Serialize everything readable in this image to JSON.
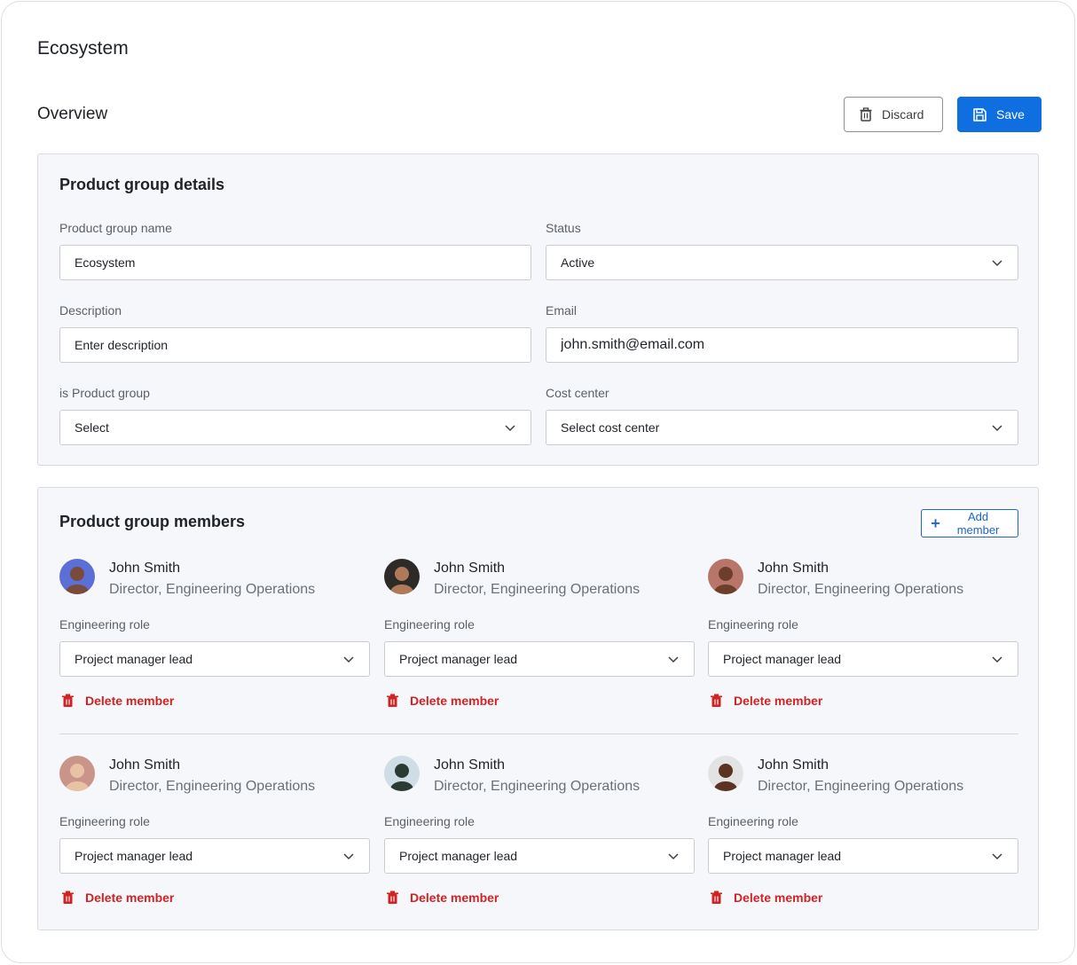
{
  "app": {
    "title": "Ecosystem"
  },
  "header": {
    "title": "Overview",
    "discard_label": "Discard",
    "save_label": "Save"
  },
  "colors": {
    "primary": "#0f6fe0",
    "danger": "#d02424",
    "card_bg": "#f5f7fa"
  },
  "details": {
    "title": "Product group details",
    "name_label": "Product group name",
    "name_value": "Ecosystem",
    "status_label": "Status",
    "status_value": "Active",
    "description_label": "Description",
    "description_placeholder": "Enter description",
    "email_label": "Email",
    "email_value": "john.smith@email.com",
    "is_group_label": "is Product group",
    "is_group_value": "Select",
    "cost_center_label": "Cost center",
    "cost_center_value": "Select cost center"
  },
  "members": {
    "title": "Product group members",
    "add_label": "Add member",
    "list": [
      {
        "name": "John Smith",
        "title": "Director, Engineering Operations",
        "role_label": "Engineering role",
        "role": "Project manager lead",
        "delete_label": "Delete member",
        "avatar_bg": "#5b6fd6",
        "avatar_skin": "#7a4a3a"
      },
      {
        "name": "John Smith",
        "title": "Director, Engineering Operations",
        "role_label": "Engineering role",
        "role": "Project manager lead",
        "delete_label": "Delete member",
        "avatar_bg": "#2d2a28",
        "avatar_skin": "#b07a5a"
      },
      {
        "name": "John Smith",
        "title": "Director, Engineering Operations",
        "role_label": "Engineering role",
        "role": "Project manager lead",
        "delete_label": "Delete member",
        "avatar_bg": "#b8756a",
        "avatar_skin": "#6e3e2c"
      },
      {
        "name": "John Smith",
        "title": "Director, Engineering Operations",
        "role_label": "Engineering role",
        "role": "Project manager lead",
        "delete_label": "Delete member",
        "avatar_bg": "#c9958a",
        "avatar_skin": "#e9c2a6"
      },
      {
        "name": "John Smith",
        "title": "Director, Engineering Operations",
        "role_label": "Engineering role",
        "role": "Project manager lead",
        "delete_label": "Delete member",
        "avatar_bg": "#cfdde6",
        "avatar_skin": "#2b3a33"
      },
      {
        "name": "John Smith",
        "title": "Director, Engineering Operations",
        "role_label": "Engineering role",
        "role": "Project manager lead",
        "delete_label": "Delete member",
        "avatar_bg": "#e3e3e3",
        "avatar_skin": "#5a3322"
      }
    ]
  }
}
